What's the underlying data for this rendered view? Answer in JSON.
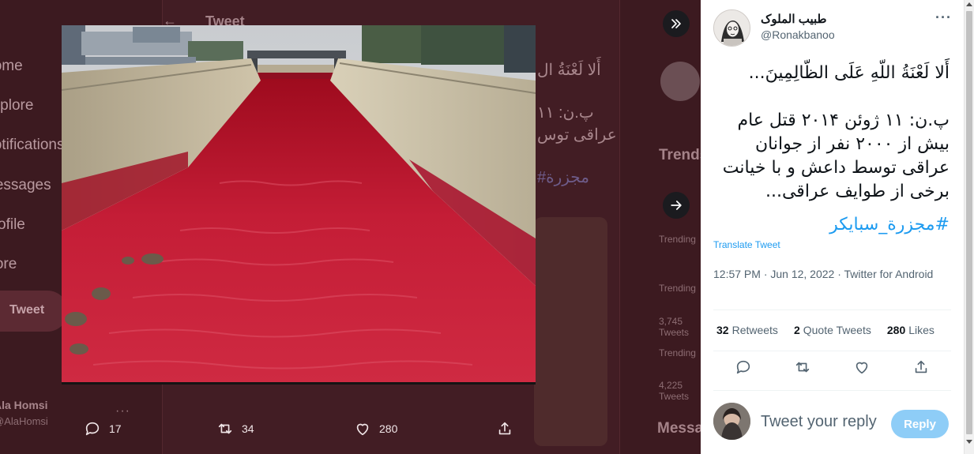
{
  "background": {
    "nav_items": [
      "Home",
      "Explore",
      "Notifications",
      "Messages",
      "Profile",
      "More"
    ],
    "tweet_button": "Tweet",
    "header_title": "Tweet",
    "user_name": "Ala Homsi",
    "user_handle": "@AlaHomsi",
    "trends_title": "Trends",
    "trend_labels": [
      "Trending",
      "Trending",
      "3,745 Tweets",
      "Trending",
      "4,225 Tweets"
    ],
    "messages_title": "Messages",
    "bg_text_1": "أَلا لَعْنَةُ ال",
    "bg_text_2": "پ.ن: ۱۱",
    "bg_text_3": "عراقی توس",
    "bg_text_4": "#مجزرة"
  },
  "media_bar": {
    "replies": "17",
    "retweets": "34",
    "likes": "280"
  },
  "tweet": {
    "display_name": "طبیب الملوک",
    "handle": "@Ronakbanoo",
    "text": "أَلا لَعْنَةُ اللّهِ عَلَى الظّالِمِينَ...\n\nپ.ن: ۱۱ ژوئن ۲۰۱۴ قتل عام بیش از ۲۰۰۰ نفر از جوانان عراقی توسط داعش و با خیانت برخی از طوایف عراقی...",
    "hashtag": "#مجزرة_سبايكر",
    "translate": "Translate Tweet",
    "meta": "12:57 PM · Jun 12, 2022 · Twitter for Android",
    "retweets": "32",
    "retweets_label": "Retweets",
    "quotes": "2",
    "quotes_label": "Quote Tweets",
    "likes": "280",
    "likes_label": "Likes"
  },
  "reply": {
    "placeholder": "Tweet your reply",
    "button": "Reply"
  },
  "colors": {
    "accent": "#1d9bf0",
    "reply_button": "#8ecdf7",
    "overlay": "#3c1a20"
  }
}
